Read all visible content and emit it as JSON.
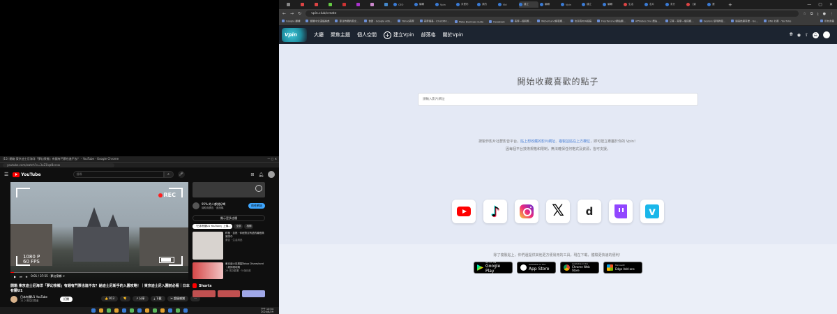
{
  "youtube": {
    "window_title": "(15) 開箱 東京迪士尼海洋「夢幻泉鄉」有錢有門票也進不去？ - YouTube - Google Chrome",
    "url": "youtube.com/watch?v=3uZ1lqzBccsw",
    "logo": "YouTube",
    "search_placeholder": "搜尋",
    "video": {
      "rec_label": "REC",
      "resolution": "1080 P",
      "fps": "60 FPS",
      "time": "0:01 / 37:55 · 夢幻泉鄉 >",
      "progress": 0.02,
      "title": "開箱 東京迪士尼海洋「夢幻泉鄉」有錢有門票也進不去？給迪士尼新手的入園攻略！｜東京迪士尼入園前必看｜日本有關U1",
      "channel": "日本有關U1 YouTube",
      "subscribers": "11.2 萬位訂閱者",
      "subscribe_label": "訂閱",
      "actions": [
        "👍 913",
        "👎",
        "↗ 分享",
        "⤓ 下載",
        "✂ 超級感謝",
        "⋯"
      ]
    },
    "sidebar": {
      "ad_text": "95% 的人都說好喝",
      "ad_sponsor": "贊助商廣告 · 邀請碼",
      "ad_cta": "前往網站",
      "more_button": "顯示更多這種",
      "chips": [
        "「日本有關U1 YouTube」上傳...",
        "全部",
        "相關"
      ],
      "items": [
        {
          "title": "終極 · 自然 · 你絕對沒有過的最經典清潔巾",
          "meta": "廣告 · 生活用品"
        },
        {
          "title": "東京迪士尼樂園Tokyo Disneyland｜超詳細攻略",
          "meta": "26 萬次觀看 · 5 個月前"
        }
      ],
      "shorts_label": "Shorts"
    },
    "taskbar_clock": "下午 10:54\n2024/8/29"
  },
  "browser": {
    "address": "vpin.club/create",
    "bookmarks": [
      "Google 翻譯",
      "繁體中文漢語辭典",
      "專注時間的英文...",
      "首頁 - Google AdS...",
      "Yahoo奇摩",
      "奇摩搜尋 - Ichat360...",
      "Meta Business Suite",
      "Facebook",
      "奇摩一個回應...",
      "WeberLand線程應...",
      "台灣商KKA投稿",
      "FreeTansner網站翻...",
      "Affiliates.One 廣告...",
      "艾蒂 - 奇摩一個回應...",
      "Explore 使用教程...",
      "搜尋結果事業 - Go...",
      "LINE 社群 - YouTube"
    ],
    "all_bookmarks": "所有書籤"
  },
  "vpin": {
    "logo": "Vpin",
    "nav": [
      "大廳",
      "聚焦主題",
      "個人空間",
      "建立Vpin",
      "部落格",
      "關於Vpin"
    ],
    "headline": "開始收藏喜歡的點子",
    "url_placeholder": "請輸入影片網址",
    "desc_line1_a": "搜製作影片社群影音平台，",
    "desc_line1_link1": "貼上想收藏的影片網址",
    "desc_line1_b": "、",
    "desc_line1_link2": "複製並貼在上方欄位",
    "desc_line1_c": "，即可建立專屬於你的 Vpin！",
    "desc_line2": "因每個平台技術規格和限制，無法確保任何格式及資源，皆可支援。",
    "platforms": [
      "youtube",
      "tiktok",
      "instagram",
      "x",
      "dcard",
      "twitch",
      "vimeo"
    ],
    "tools_text": "除了複製貼上，你們還提供其他更方便易用的工具，現在下載，體驗更快速的便利！",
    "stores": [
      {
        "small": "GET IT ON",
        "big": "Google Play"
      },
      {
        "small": "Available on the",
        "big": "App Store"
      },
      {
        "small": "Available in the",
        "big": "Chrome Web Store"
      },
      {
        "small": "Microsoft",
        "big": "Edge Add-ons"
      }
    ]
  }
}
